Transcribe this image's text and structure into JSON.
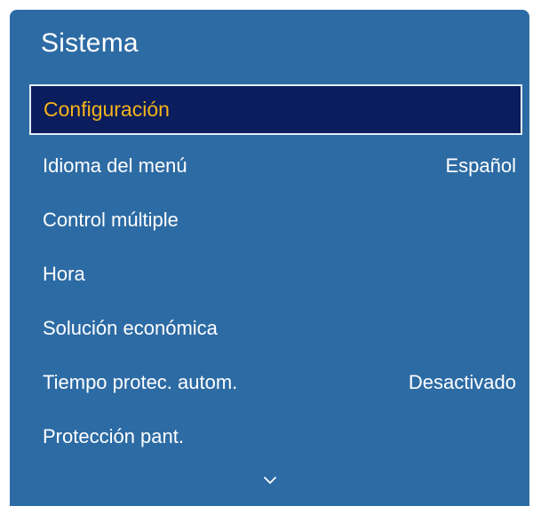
{
  "panel": {
    "title": "Sistema",
    "background": "#2d6ba4",
    "selected_background": "#0b1d5c",
    "selected_text_color": "#f6b41b"
  },
  "menu": {
    "items": [
      {
        "label": "Configuración",
        "value": "",
        "selected": true
      },
      {
        "label": "Idioma del menú",
        "value": "Español",
        "selected": false
      },
      {
        "label": "Control múltiple",
        "value": "",
        "selected": false
      },
      {
        "label": "Hora",
        "value": "",
        "selected": false
      },
      {
        "label": "Solución económica",
        "value": "",
        "selected": false
      },
      {
        "label": "Tiempo protec. autom.",
        "value": "Desactivado",
        "selected": false
      },
      {
        "label": "Protección pant.",
        "value": "",
        "selected": false
      }
    ]
  },
  "icons": {
    "scroll_more": "chevron-down-icon"
  }
}
